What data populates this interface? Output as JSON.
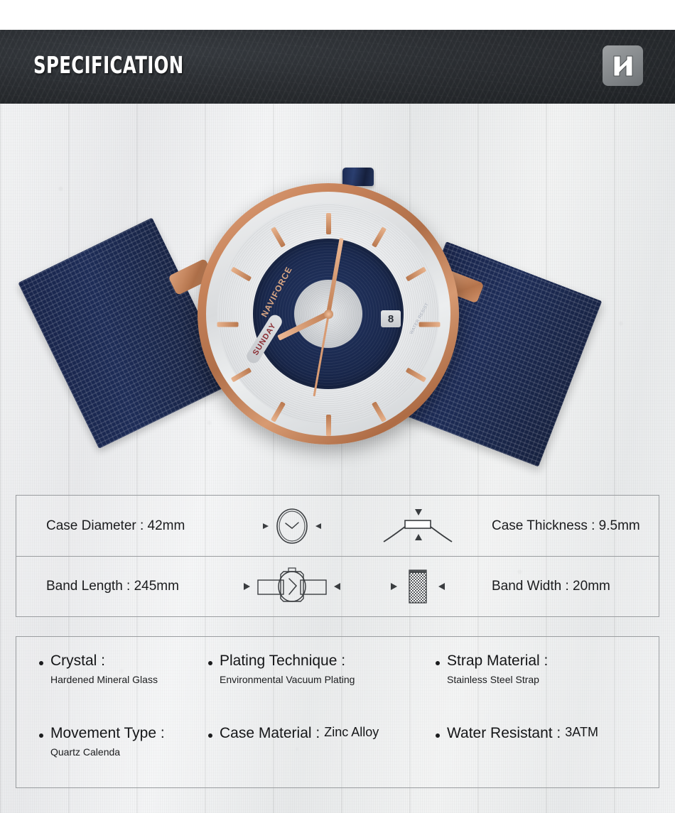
{
  "header": {
    "title": "SPECIFICATION",
    "logo_icon": "naviforce-n-logo-icon",
    "background_color": "#2a2d31",
    "title_color": "#ffffff"
  },
  "product_photo": {
    "alt_name": "naviforce-blue-mesh-watch",
    "dial_brand": "NAVIFORCE",
    "day_window": "SUNDAY",
    "date_window": "8",
    "dial_small_text": "WATER RESIST",
    "case_color": "#c9855c",
    "band_color": "#1b2a52",
    "dial_color": "#1b2a50"
  },
  "measurements": [
    {
      "left_label": "Case Diameter : 42mm",
      "left_icon": "watch-face-diameter-icon",
      "right_label": "Case Thickness : 9.5mm",
      "right_icon": "watch-side-thickness-icon"
    },
    {
      "left_label": "Band Length : 245mm",
      "left_icon": "watch-band-length-icon",
      "right_label": "Band Width : 20mm",
      "right_icon": "mesh-band-width-icon"
    }
  ],
  "features": [
    [
      {
        "title": "Crystal :",
        "value": "Hardened Mineral Glass",
        "inline": false
      },
      {
        "title": "Plating Technique :",
        "value": "Environmental Vacuum Plating",
        "inline": false
      },
      {
        "title": "Strap Material :",
        "value": "Stainless Steel Strap",
        "inline": false
      }
    ],
    [
      {
        "title": "Movement Type :",
        "value": "Quartz Calenda",
        "inline": false
      },
      {
        "title": "Case Material :",
        "value": "Zinc Alloy",
        "inline": true
      },
      {
        "title": "Water Resistant :",
        "value": "3ATM",
        "inline": true
      }
    ]
  ]
}
